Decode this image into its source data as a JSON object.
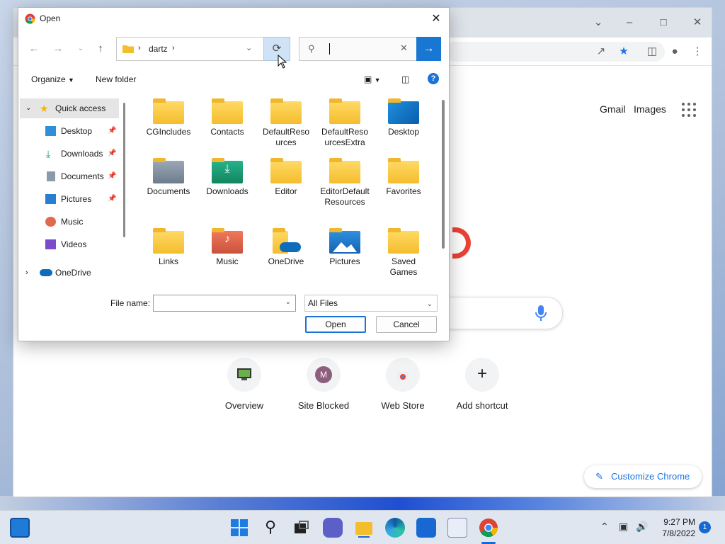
{
  "dialog": {
    "title": "Open",
    "breadcrumb": "dartz",
    "search_placeholder": "",
    "organize_label": "Organize",
    "new_folder_label": "New folder",
    "file_name_label": "File name:",
    "file_name_value": "",
    "file_type_selected": "All Files",
    "open_label": "Open",
    "cancel_label": "Cancel"
  },
  "nav_pane": {
    "quick_access": "Quick access",
    "items": [
      {
        "label": "Desktop",
        "icon": "desktop-icon",
        "pinned": true
      },
      {
        "label": "Downloads",
        "icon": "download-icon",
        "pinned": true
      },
      {
        "label": "Documents",
        "icon": "documents-icon",
        "pinned": true
      },
      {
        "label": "Pictures",
        "icon": "pictures-icon",
        "pinned": true
      },
      {
        "label": "Music",
        "icon": "music-icon",
        "pinned": false
      },
      {
        "label": "Videos",
        "icon": "videos-icon",
        "pinned": false
      }
    ],
    "onedrive": "OneDrive"
  },
  "files": [
    {
      "name": "CGIncludes",
      "icon": "folder"
    },
    {
      "name": "Contacts",
      "icon": "folder"
    },
    {
      "name": "DefaultResources",
      "icon": "folder"
    },
    {
      "name": "DefaultResourcesExtra",
      "icon": "folder"
    },
    {
      "name": "Desktop",
      "icon": "desktop-folder"
    },
    {
      "name": "Documents",
      "icon": "documents-folder"
    },
    {
      "name": "Downloads",
      "icon": "downloads-folder"
    },
    {
      "name": "Editor",
      "icon": "folder"
    },
    {
      "name": "EditorDefaultResources",
      "icon": "folder"
    },
    {
      "name": "Favorites",
      "icon": "folder"
    },
    {
      "name": "Links",
      "icon": "folder"
    },
    {
      "name": "Music",
      "icon": "music-folder"
    },
    {
      "name": "OneDrive",
      "icon": "onedrive-folder"
    },
    {
      "name": "Pictures",
      "icon": "pictures-folder"
    },
    {
      "name": "Saved Games",
      "icon": "folder"
    }
  ],
  "chrome": {
    "gmail": "Gmail",
    "images": "Images",
    "shortcuts": [
      {
        "label": "Overview"
      },
      {
        "label": "Site Blocked",
        "initial": "M"
      },
      {
        "label": "Web Store"
      },
      {
        "label": "Add shortcut"
      }
    ],
    "customize_label": "Customize Chrome"
  },
  "taskbar": {
    "time": "9:27 PM",
    "date": "7/8/2022",
    "notification_count": "1"
  },
  "colors": {
    "accent": "#1877d2",
    "chrome_blue": "#1a73e8",
    "folder_yellow": "#f9cc49"
  }
}
